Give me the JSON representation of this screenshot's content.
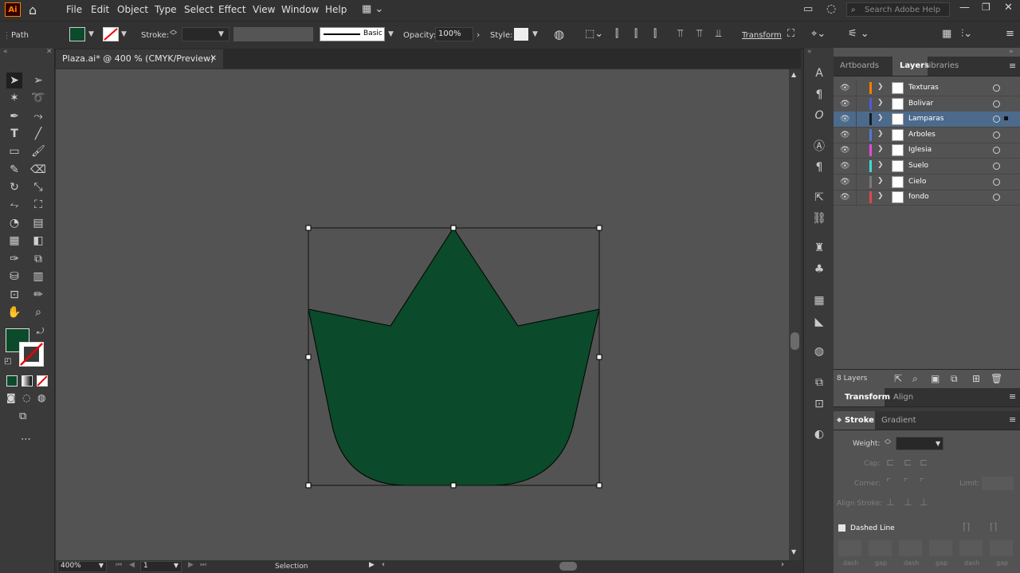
{
  "app": {
    "logo": "Ai"
  },
  "menu": [
    "File",
    "Edit",
    "Object",
    "Type",
    "Select",
    "Effect",
    "View",
    "Window",
    "Help"
  ],
  "search": {
    "placeholder": "Search Adobe Help"
  },
  "control": {
    "selection_type": "Path",
    "fill_color": "#0b4a2a",
    "stroke_label": "Stroke:",
    "brush_label": "Basic",
    "opacity_label": "Opacity:",
    "opacity_value": "100%",
    "style_label": "Style:",
    "transform_label": "Transform"
  },
  "document": {
    "tab_title": "Plaza.ai* @ 400 % (CMYK/Preview)",
    "shape_fill": "#0b4a2a",
    "canvas_color": "#535353"
  },
  "status": {
    "zoom": "400%",
    "artboard": "1",
    "tool": "Selection"
  },
  "panels": {
    "top_tabs": [
      "Artboards",
      "Layers",
      "Libraries"
    ],
    "active_tab": "Layers",
    "layers": [
      {
        "name": "Texturas",
        "color": "#ff7c00",
        "selected": false
      },
      {
        "name": "Bolivar",
        "color": "#4f5bd5",
        "selected": false
      },
      {
        "name": "Lamparas",
        "color": "#1a1a1a",
        "selected": true
      },
      {
        "name": "Arboles",
        "color": "#4f7bd5",
        "selected": false
      },
      {
        "name": "Iglesia",
        "color": "#e24cd6",
        "selected": false
      },
      {
        "name": "Suelo",
        "color": "#3fd9d9",
        "selected": false
      },
      {
        "name": "Cielo",
        "color": "#7a7a7a",
        "selected": false
      },
      {
        "name": "fondo",
        "color": "#e04848",
        "selected": false
      }
    ],
    "layer_count": "8 Layers",
    "transform_tabs": [
      "Transform",
      "Align"
    ],
    "stroke_tabs": [
      "Stroke",
      "Gradient"
    ],
    "stroke": {
      "weight_label": "Weight:",
      "cap_label": "Cap:",
      "corner_label": "Corner:",
      "limit_label": "Limit:",
      "align_label": "Align Stroke:",
      "dashed_label": "Dashed Line",
      "dash_labels": [
        "dash",
        "gap",
        "dash",
        "gap",
        "dash",
        "gap"
      ]
    }
  }
}
